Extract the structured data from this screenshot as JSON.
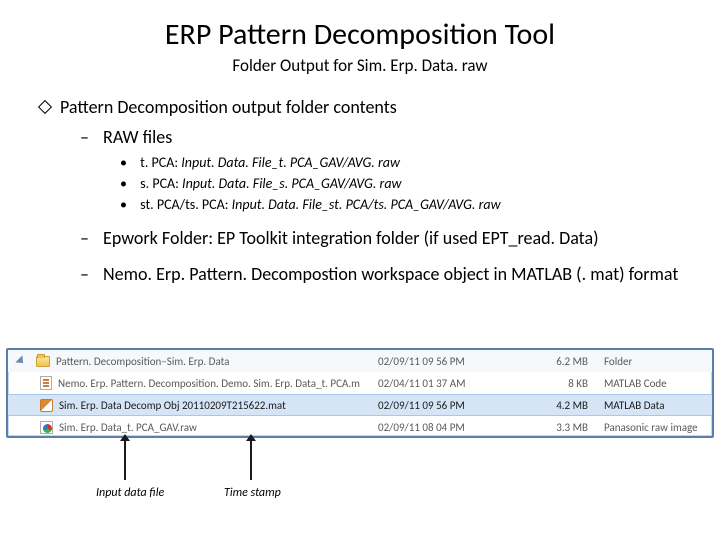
{
  "title": "ERP Pattern Decomposition Tool",
  "subtitle": "Folder Output for Sim. Erp. Data. raw",
  "section_heading": "Pattern Decomposition output folder contents",
  "dash1": "RAW files",
  "dots": {
    "a_label": "t. PCA:",
    "a_val": "Input. Data. File_t. PCA_GAV/AVG. raw",
    "b_label": "s. PCA:",
    "b_val": "Input. Data. File_s. PCA_GAV/AVG. raw",
    "c_label": "st. PCA/ts. PCA:",
    "c_val": "Input. Data. File_st. PCA/ts. PCA_GAV/AVG. raw"
  },
  "dash2": "Epwork Folder: EP Toolkit integration folder (if used EPT_read. Data)",
  "dash3": "Nemo. Erp. Pattern. Decompostion workspace object in MATLAB (. mat) format",
  "files": [
    {
      "name": "Pattern. Decomposition–Sim. Erp. Data",
      "date": "02/09/11 09 56 PM",
      "size": "6.2 MB",
      "type": "Folder",
      "icon": "folder"
    },
    {
      "name": "Nemo. Erp. Pattern. Decomposition. Demo. Sim. Erp. Data_t. PCA.m",
      "date": "02/04/11 01 37 AM",
      "size": "8 KB",
      "type": "MATLAB Code",
      "icon": "doc"
    },
    {
      "name": "Sim. Erp. Data Decomp Obj 20110209T215622.mat",
      "date": "02/09/11 09 56 PM",
      "size": "4.2 MB",
      "type": "MATLAB Data",
      "icon": "mat"
    },
    {
      "name": "Sim. Erp. Data_t. PCA_GAV.raw",
      "date": "02/09/11 08 04 PM",
      "size": "3.3 MB",
      "type": "Panasonic raw image",
      "icon": "raw"
    }
  ],
  "callout1": "Input data file",
  "callout2": "Time stamp"
}
